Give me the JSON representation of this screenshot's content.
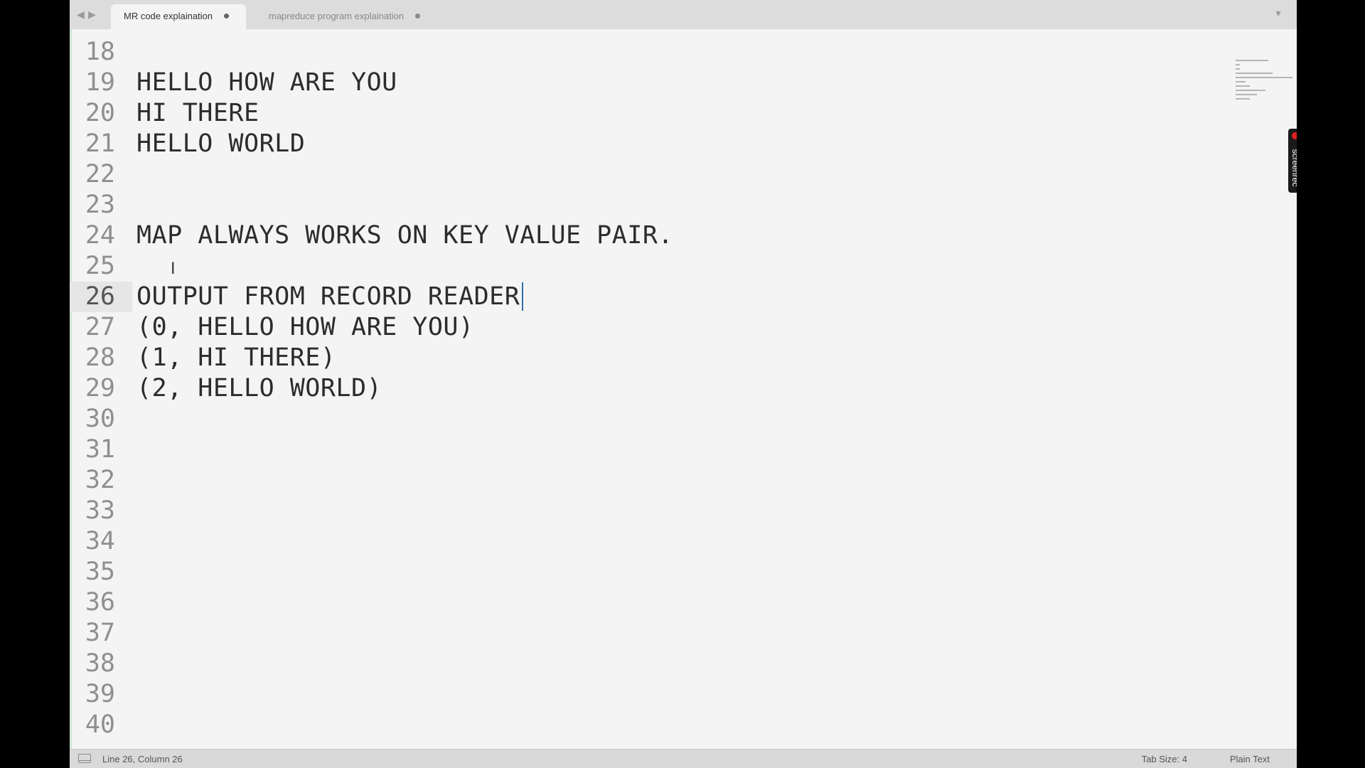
{
  "tabs": [
    {
      "label": "MR code explaination",
      "active": true
    },
    {
      "label": "mapreduce program explaination",
      "active": false
    }
  ],
  "nav": {
    "back": "◀",
    "forward": "▶",
    "dropdown": "▼"
  },
  "editor": {
    "current_line": 26,
    "lines": [
      {
        "num": "18",
        "text": ""
      },
      {
        "num": "19",
        "text": "HELLO HOW ARE YOU"
      },
      {
        "num": "20",
        "text": "HI THERE"
      },
      {
        "num": "21",
        "text": "HELLO WORLD"
      },
      {
        "num": "22",
        "text": ""
      },
      {
        "num": "23",
        "text": ""
      },
      {
        "num": "24",
        "text": "MAP ALWAYS WORKS ON KEY VALUE PAIR."
      },
      {
        "num": "25",
        "text": ""
      },
      {
        "num": "26",
        "text": "OUTPUT FROM RECORD READER"
      },
      {
        "num": "27",
        "text": "(0, HELLO HOW ARE YOU)"
      },
      {
        "num": "28",
        "text": "(1, HI THERE)"
      },
      {
        "num": "29",
        "text": "(2, HELLO WORLD)"
      },
      {
        "num": "30",
        "text": ""
      },
      {
        "num": "31",
        "text": ""
      },
      {
        "num": "32",
        "text": ""
      },
      {
        "num": "33",
        "text": ""
      },
      {
        "num": "34",
        "text": ""
      },
      {
        "num": "35",
        "text": ""
      },
      {
        "num": "36",
        "text": ""
      },
      {
        "num": "37",
        "text": ""
      },
      {
        "num": "38",
        "text": ""
      },
      {
        "num": "39",
        "text": ""
      },
      {
        "num": "40",
        "text": ""
      }
    ]
  },
  "overlay": {
    "recorder_label": "screenrec",
    "ibeam_glyph": "I"
  },
  "status": {
    "position": "Line 26, Column 26",
    "tab_size": "Tab Size: 4",
    "syntax": "Plain Text"
  },
  "colors": {
    "caret": "#2f6fa8",
    "record_dot": "#e02020"
  }
}
